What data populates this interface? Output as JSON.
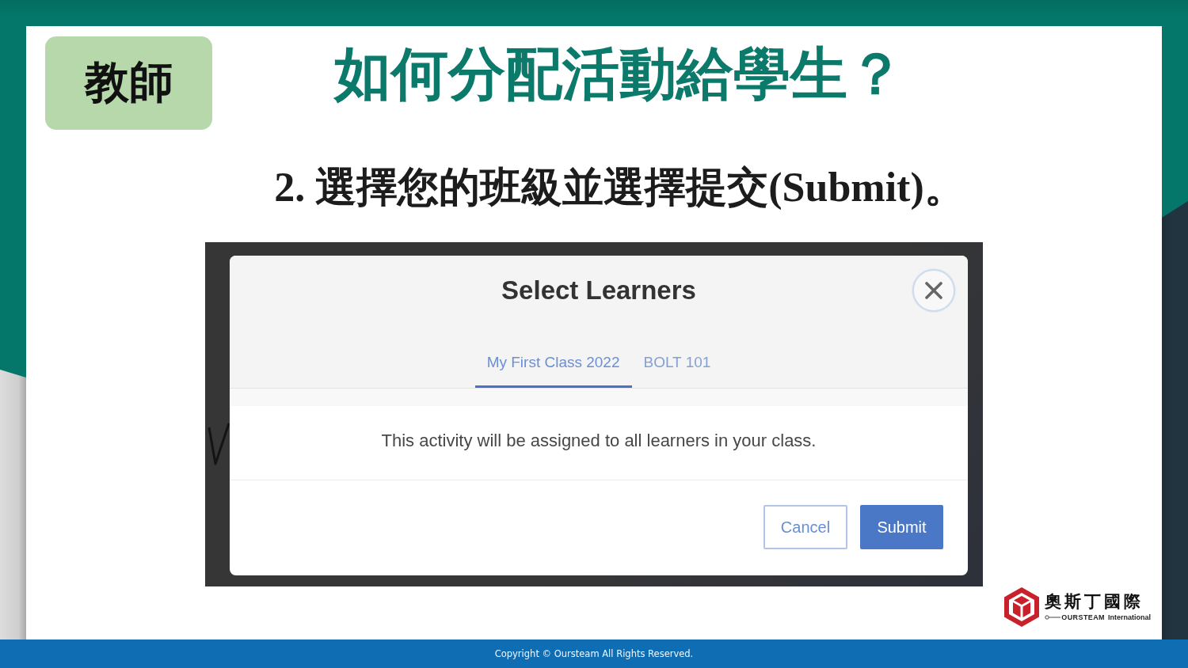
{
  "badge": "教師",
  "title": "如何分配活動給學生？",
  "step": "2. 選擇您的班級並選擇提交(Submit)。",
  "dialog": {
    "title": "Select Learners",
    "tabs": [
      {
        "label": "My First Class 2022",
        "selected": true
      },
      {
        "label": "BOLT 101",
        "selected": false
      }
    ],
    "message": "This activity will be assigned to all learners in your class.",
    "buttons": [
      {
        "label": "Cancel",
        "kind": "secondary"
      },
      {
        "label": "Submit",
        "kind": "primary"
      }
    ]
  },
  "logo": {
    "name": "奧斯丁國際",
    "brand": "OURSTEAM",
    "tagline": "International"
  },
  "footer": {
    "copyright": "Copyright © Oursteam All Rights Reserved."
  }
}
